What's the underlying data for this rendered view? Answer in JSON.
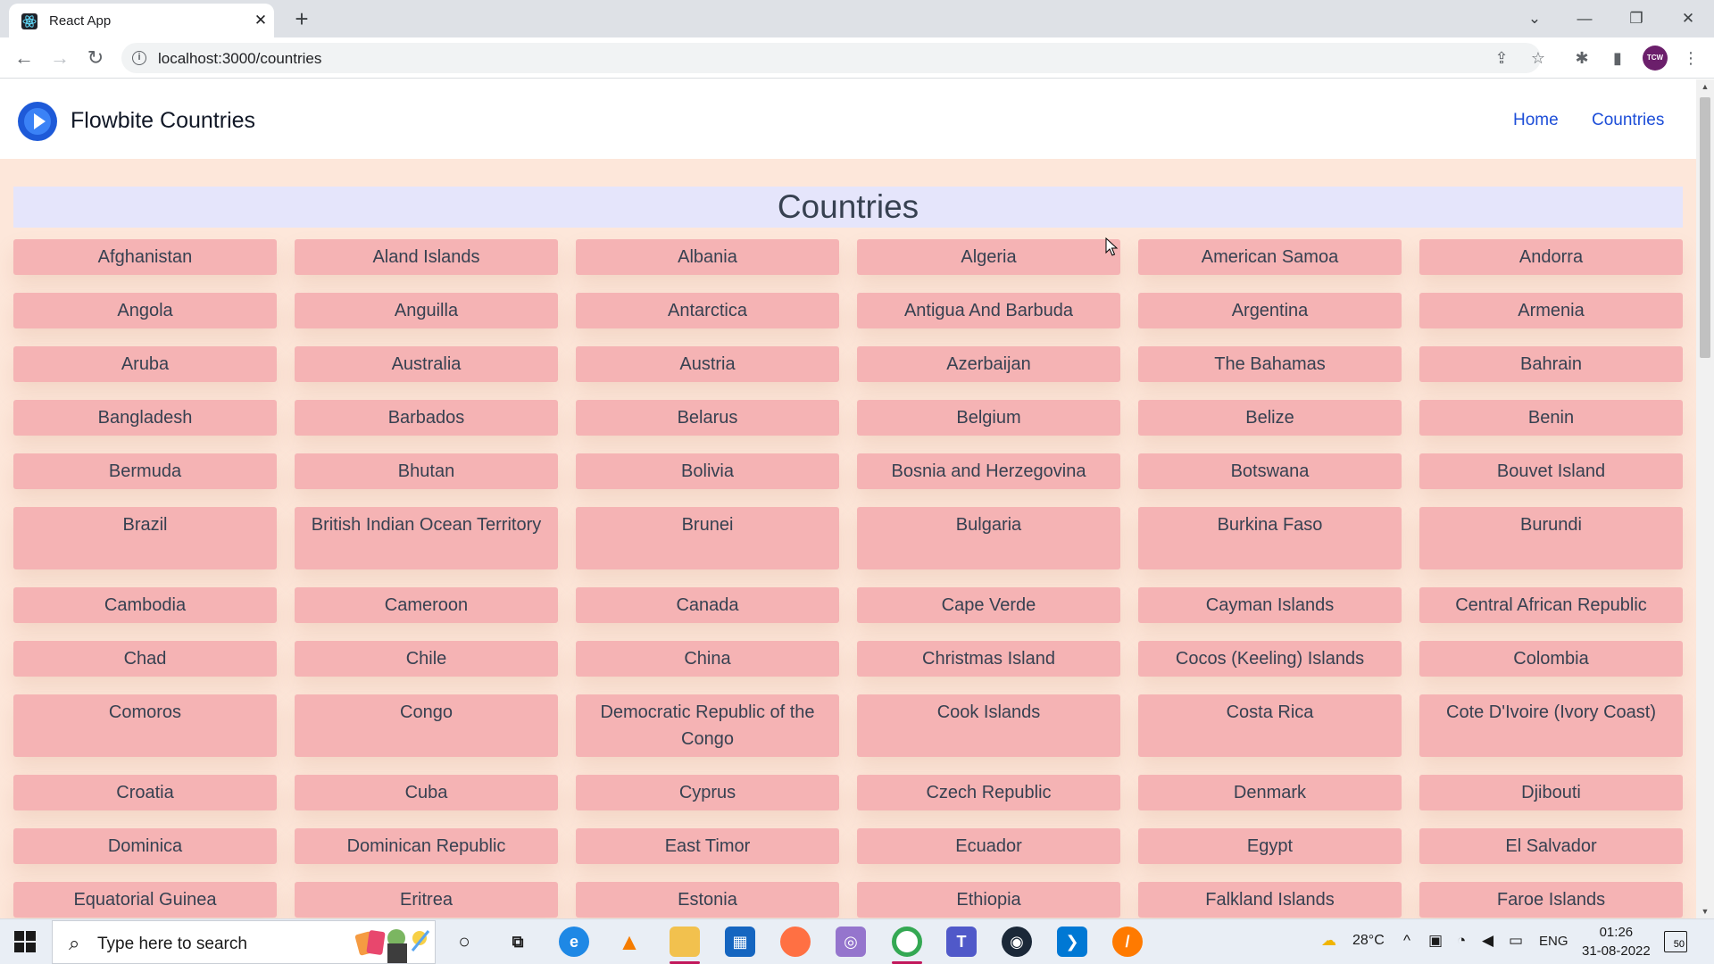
{
  "browser": {
    "tab_title": "React App",
    "tab_close": "✕",
    "new_tab": "+",
    "url": "localhost:3000/countries",
    "window_controls": {
      "collapse": "⌄",
      "minimize": "—",
      "restore": "❐",
      "close": "✕"
    },
    "icons": [
      "back-icon",
      "forward-icon",
      "reload-icon",
      "info-icon",
      "share-icon",
      "star-icon",
      "extensions-icon",
      "sidepanel-icon",
      "menu-icon"
    ],
    "profile_initials": "TCW"
  },
  "navbar": {
    "brand": "Flowbite Countries",
    "links": [
      "Home",
      "Countries"
    ]
  },
  "page": {
    "heading": "Countries",
    "rows": [
      [
        "Afghanistan",
        "Aland Islands",
        "Albania",
        "Algeria",
        "American Samoa",
        "Andorra"
      ],
      [
        "Angola",
        "Anguilla",
        "Antarctica",
        "Antigua And Barbuda",
        "Argentina",
        "Armenia"
      ],
      [
        "Aruba",
        "Australia",
        "Austria",
        "Azerbaijan",
        "The Bahamas",
        "Bahrain"
      ],
      [
        "Bangladesh",
        "Barbados",
        "Belarus",
        "Belgium",
        "Belize",
        "Benin"
      ],
      [
        "Bermuda",
        "Bhutan",
        "Bolivia",
        "Bosnia and Herzegovina",
        "Botswana",
        "Bouvet Island"
      ],
      [
        "Brazil",
        "British Indian Ocean Territory",
        "Brunei",
        "Bulgaria",
        "Burkina Faso",
        "Burundi"
      ],
      [
        "Cambodia",
        "Cameroon",
        "Canada",
        "Cape Verde",
        "Cayman Islands",
        "Central African Republic"
      ],
      [
        "Chad",
        "Chile",
        "China",
        "Christmas Island",
        "Cocos (Keeling) Islands",
        "Colombia"
      ],
      [
        "Comoros",
        "Congo",
        "Democratic Republic of the Congo",
        "Cook Islands",
        "Costa Rica",
        "Cote D'Ivoire (Ivory Coast)"
      ],
      [
        "Croatia",
        "Cuba",
        "Cyprus",
        "Czech Republic",
        "Denmark",
        "Djibouti"
      ],
      [
        "Dominica",
        "Dominican Republic",
        "East Timor",
        "Ecuador",
        "Egypt",
        "El Salvador"
      ],
      [
        "Equatorial Guinea",
        "Eritrea",
        "Estonia",
        "Ethiopia",
        "Falkland Islands",
        "Faroe Islands"
      ]
    ]
  },
  "taskbar": {
    "search_placeholder": "Type here to search",
    "weather": "28°C",
    "language": "ENG",
    "time": "01:26",
    "date": "31-08-2022",
    "notifications": "50",
    "apps": [
      "cortana-icon",
      "task-view-icon",
      "edge-icon",
      "vlc-icon",
      "file-explorer-icon",
      "store-icon",
      "firefox-icon",
      "photos-icon",
      "chrome-icon",
      "teams-icon",
      "steam-icon",
      "vscode-icon",
      "app-icon"
    ]
  }
}
